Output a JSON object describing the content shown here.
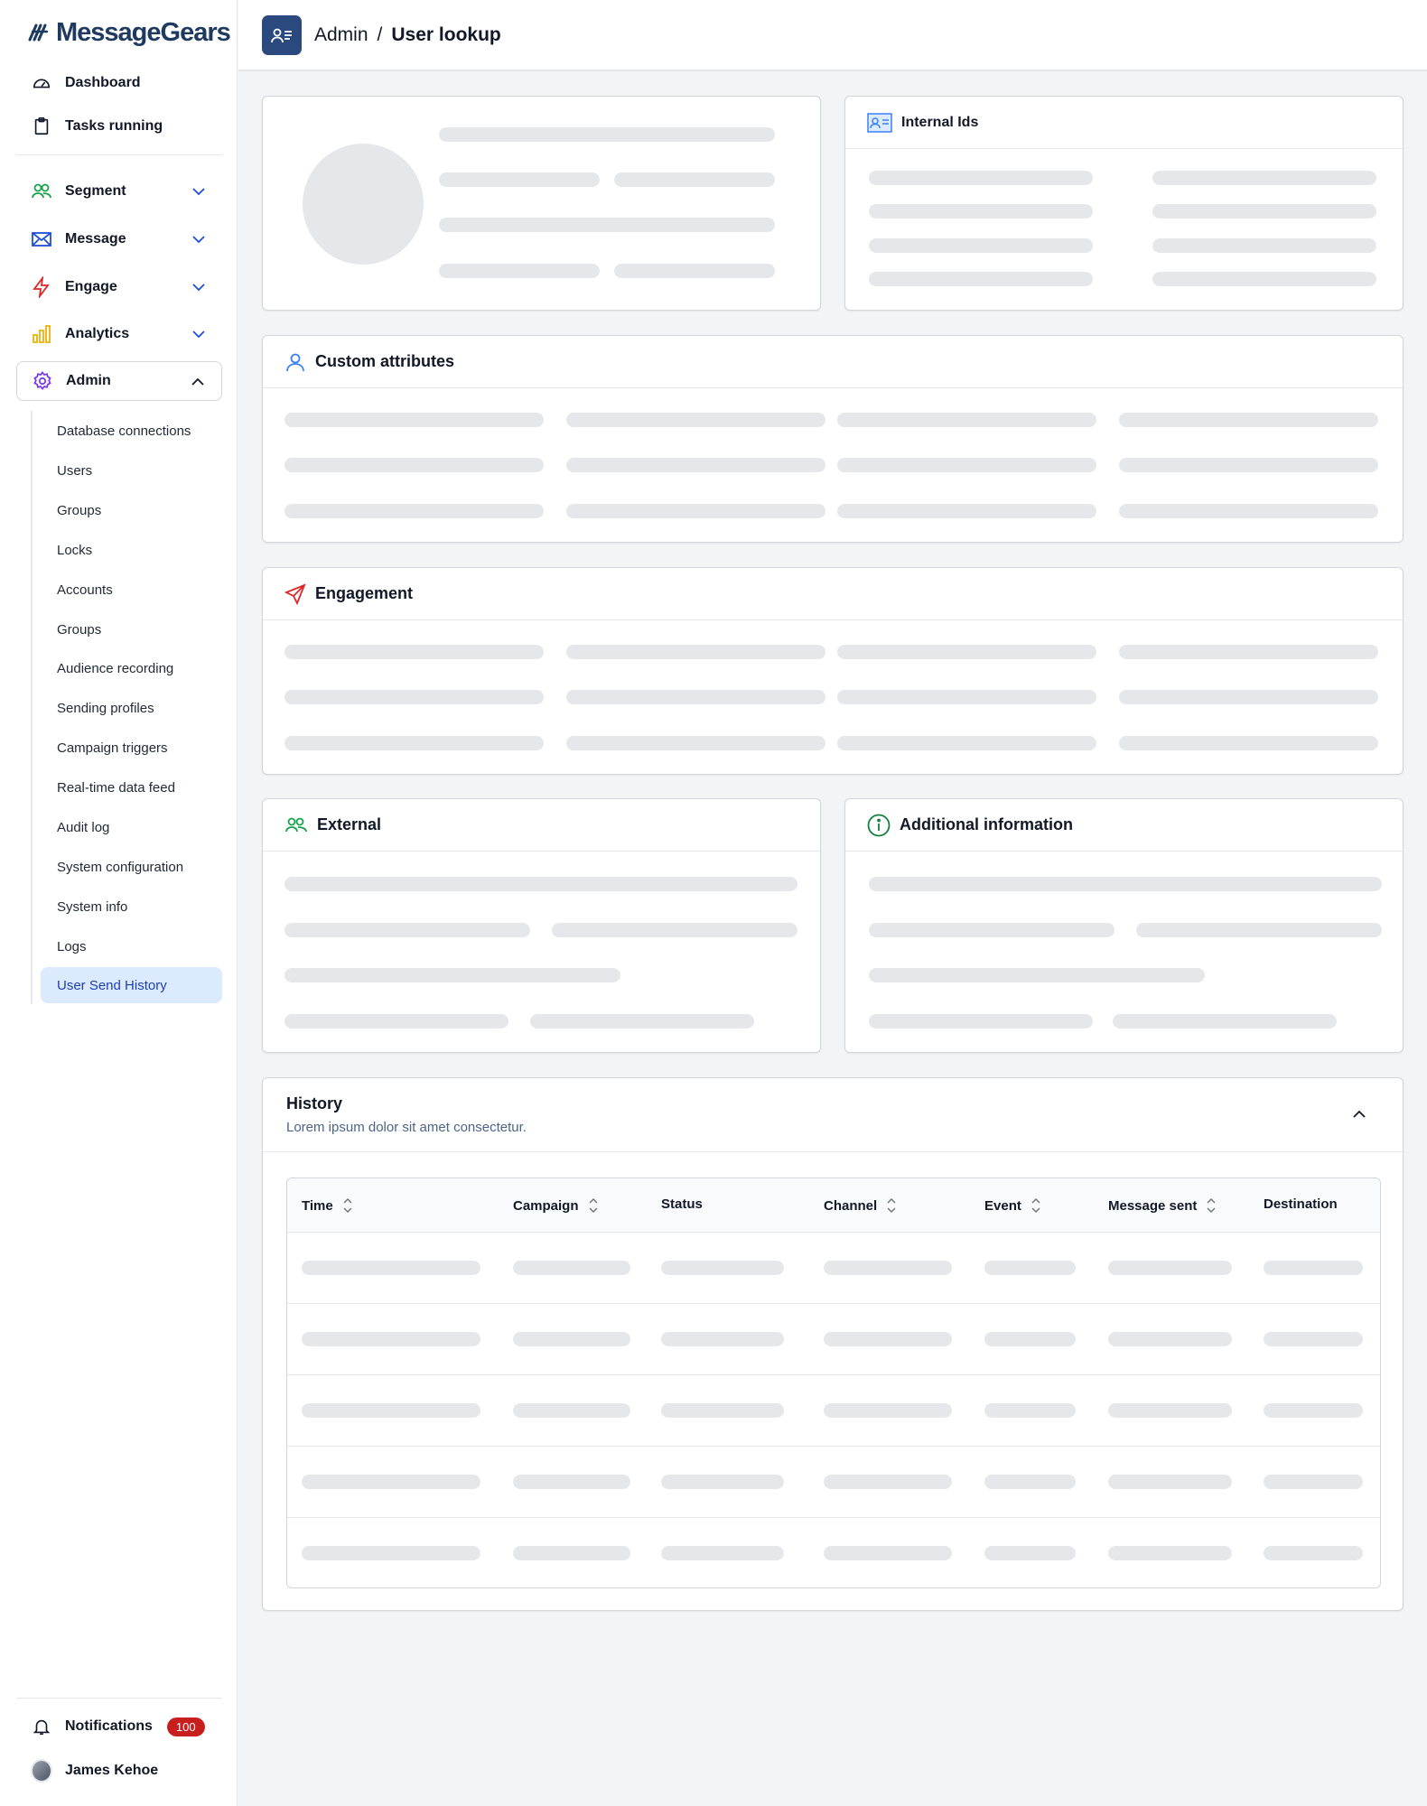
{
  "app": {
    "brand": "MessageGears"
  },
  "header": {
    "section": "Admin",
    "separator": "/",
    "current": "User lookup"
  },
  "sidebar": {
    "top_items": [
      {
        "label": "Dashboard",
        "icon": "dashboard-icon"
      },
      {
        "label": "Tasks running",
        "icon": "clipboard-icon"
      }
    ],
    "groups": [
      {
        "label": "Segment",
        "icon": "users-icon",
        "icon_color": "#16a34a",
        "expanded": false
      },
      {
        "label": "Message",
        "icon": "envelope-icon",
        "icon_color": "#1d4ed8",
        "expanded": false
      },
      {
        "label": "Engage",
        "icon": "bolt-icon",
        "icon_color": "#dc2626",
        "expanded": false
      },
      {
        "label": "Analytics",
        "icon": "bar-chart-icon",
        "icon_color": "#eab308",
        "expanded": false
      },
      {
        "label": "Admin",
        "icon": "gear-icon",
        "icon_color": "#7c3aed",
        "expanded": true
      }
    ],
    "admin_items": [
      "Database connections",
      "Users",
      "Groups",
      "Locks",
      "Accounts",
      "Groups",
      "Audience recording",
      "Sending profiles",
      "Campaign triggers",
      "Real-time data feed",
      "Audit log",
      "System configuration",
      "System info",
      "Logs",
      "User Send History"
    ],
    "active_item": "User Send History",
    "notifications": {
      "label": "Notifications",
      "count": "100"
    },
    "user": {
      "name": "James Kehoe"
    }
  },
  "cards": {
    "internal_ids": {
      "title": "Internal Ids"
    },
    "custom_attributes": {
      "title": "Custom attributes"
    },
    "engagement": {
      "title": "Engagement"
    },
    "external": {
      "title": "External"
    },
    "additional": {
      "title": "Additional information"
    }
  },
  "history": {
    "title": "History",
    "subtitle": "Lorem ipsum dolor sit amet consectetur.",
    "columns": [
      {
        "label": "Time",
        "sortable": true
      },
      {
        "label": "Campaign",
        "sortable": true
      },
      {
        "label": "Status",
        "sortable": false
      },
      {
        "label": "Channel",
        "sortable": true
      },
      {
        "label": "Event",
        "sortable": true
      },
      {
        "label": "Message sent",
        "sortable": true
      },
      {
        "label": "Destination",
        "sortable": false
      }
    ],
    "loading_rows": 5
  },
  "colors": {
    "brand": "#1e3a5f",
    "header_icon_bg": "#2a4a7f",
    "active_bg": "#dbeafe",
    "badge": "#c81e1e",
    "skeleton": "#e5e7eb"
  }
}
